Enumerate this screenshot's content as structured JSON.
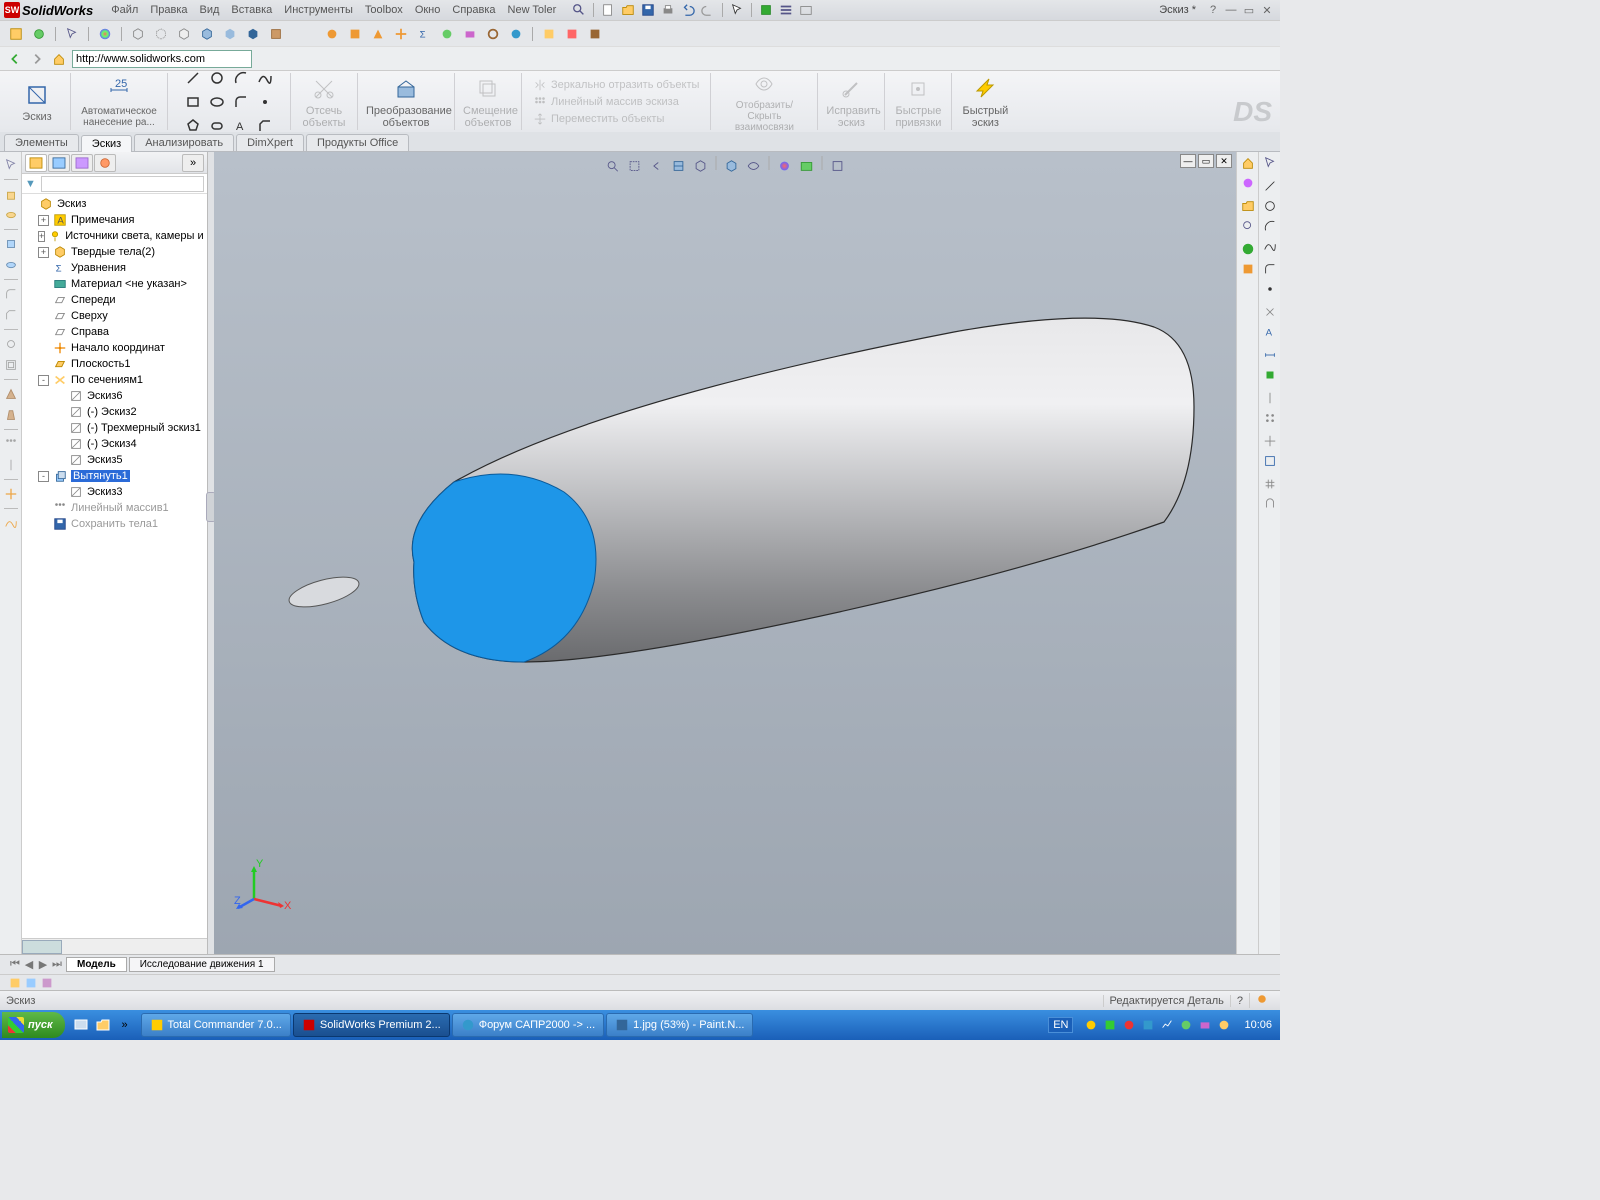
{
  "app_name": "SolidWorks",
  "doc_name": "Эскиз *",
  "menus": [
    "Файл",
    "Правка",
    "Вид",
    "Вставка",
    "Инструменты",
    "Toolbox",
    "Окно",
    "Справка",
    "New Toler"
  ],
  "address_url": "http://www.solidworks.com",
  "ribbon": {
    "sketch": "Эскиз",
    "autodim": "Автоматическое нанесение ра...",
    "trim": "Отсечь объекты",
    "convert": "Преобразование объектов",
    "offset": "Смещение объектов",
    "mirror": "Зеркально отразить объекты",
    "pattern": "Линейный массив эскиза",
    "move": "Переместить объекты",
    "show_hide": "Отобразить/Скрыть взаимосвязи",
    "repair": "Исправить эскиз",
    "quicksnap": "Быстрые привязки",
    "rapidsketch": "Быстрый эскиз"
  },
  "cmd_tabs": [
    "Элементы",
    "Эскиз",
    "Анализировать",
    "DimXpert",
    "Продукты Office"
  ],
  "cmd_tab_active": 1,
  "tree": {
    "root": "Эскиз",
    "nodes": [
      {
        "exp": "+",
        "icon": "A",
        "label": "Примечания",
        "indent": 1
      },
      {
        "exp": "+",
        "icon": "light",
        "label": "Источники света, камеры и сцены",
        "indent": 1
      },
      {
        "exp": "+",
        "icon": "solid",
        "label": "Твердые тела(2)",
        "indent": 1
      },
      {
        "exp": "",
        "icon": "sigma",
        "label": "Уравнения",
        "indent": 1
      },
      {
        "exp": "",
        "icon": "mat",
        "label": "Материал <не указан>",
        "indent": 1
      },
      {
        "exp": "",
        "icon": "plane",
        "label": "Спереди",
        "indent": 1
      },
      {
        "exp": "",
        "icon": "plane",
        "label": "Сверху",
        "indent": 1
      },
      {
        "exp": "",
        "icon": "plane",
        "label": "Справа",
        "indent": 1
      },
      {
        "exp": "",
        "icon": "origin",
        "label": "Начало координат",
        "indent": 1
      },
      {
        "exp": "",
        "icon": "plane2",
        "label": "Плоскость1",
        "indent": 1
      },
      {
        "exp": "-",
        "icon": "loft",
        "label": "По сечениям1",
        "indent": 1
      },
      {
        "exp": "",
        "icon": "sk",
        "label": "Эскиз6",
        "indent": 2
      },
      {
        "exp": "",
        "icon": "sk",
        "label": "(-) Эскиз2",
        "indent": 2
      },
      {
        "exp": "",
        "icon": "sk",
        "label": "(-) Трехмерный эскиз1",
        "indent": 2
      },
      {
        "exp": "",
        "icon": "sk",
        "label": "(-) Эскиз4",
        "indent": 2
      },
      {
        "exp": "",
        "icon": "sk",
        "label": "Эскиз5",
        "indent": 2
      },
      {
        "exp": "-",
        "icon": "ext",
        "label": "Вытянуть1",
        "indent": 1,
        "selected": true
      },
      {
        "exp": "",
        "icon": "sk",
        "label": "Эскиз3",
        "indent": 2
      },
      {
        "exp": "",
        "icon": "patt",
        "label": "Линейный массив1",
        "indent": 1,
        "dim": true
      },
      {
        "exp": "",
        "icon": "save",
        "label": "Сохранить тела1",
        "indent": 1,
        "dim": true
      }
    ]
  },
  "model_tabs": [
    "Модель",
    "Исследование движения 1"
  ],
  "status_left": "Эскиз",
  "status_right": "Редактируется Деталь",
  "taskbar": {
    "start": "пуск",
    "tasks": [
      {
        "label": "Total Commander 7.0...",
        "active": false
      },
      {
        "label": "SolidWorks Premium 2...",
        "active": true
      },
      {
        "label": "Форум САПР2000 -> ...",
        "active": false
      },
      {
        "label": "1.jpg (53%) - Paint.N...",
        "active": false
      }
    ],
    "lang": "EN",
    "clock": "10:06"
  }
}
